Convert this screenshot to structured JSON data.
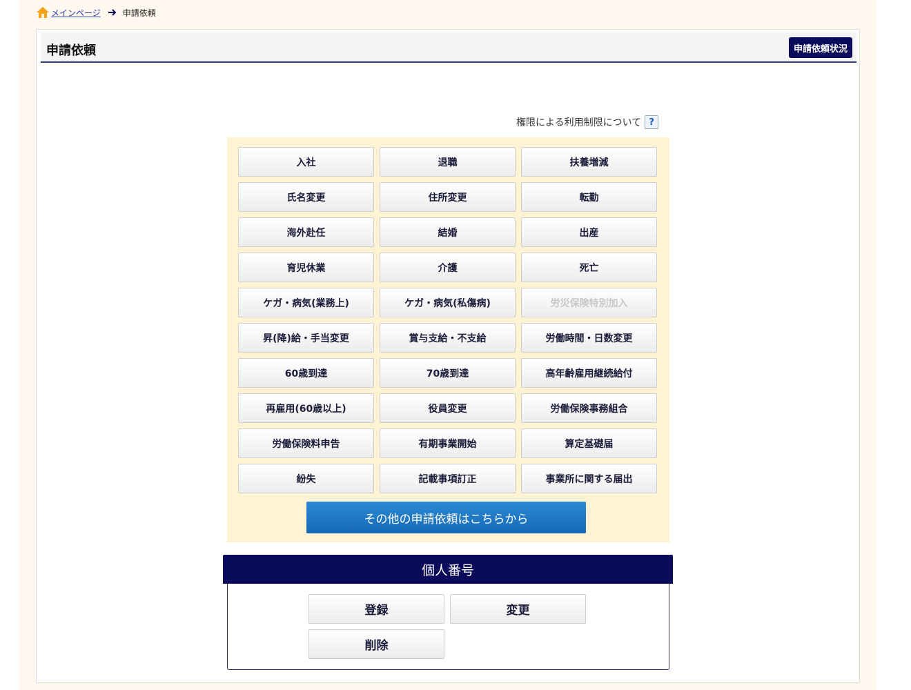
{
  "breadcrumb": {
    "home_icon": "home-icon",
    "home_label": "メインページ",
    "current": "申請依頼"
  },
  "header": {
    "title": "申請依頼",
    "status_button": "申請依頼状況"
  },
  "restriction": {
    "label": "権限による利用制限について",
    "help": "?"
  },
  "applications": [
    {
      "label": "入社",
      "enabled": true
    },
    {
      "label": "退職",
      "enabled": true
    },
    {
      "label": "扶養増減",
      "enabled": true
    },
    {
      "label": "氏名変更",
      "enabled": true
    },
    {
      "label": "住所変更",
      "enabled": true
    },
    {
      "label": "転勤",
      "enabled": true
    },
    {
      "label": "海外赴任",
      "enabled": true
    },
    {
      "label": "結婚",
      "enabled": true
    },
    {
      "label": "出産",
      "enabled": true
    },
    {
      "label": "育児休業",
      "enabled": true
    },
    {
      "label": "介護",
      "enabled": true
    },
    {
      "label": "死亡",
      "enabled": true
    },
    {
      "label": "ケガ・病気(業務上)",
      "enabled": true
    },
    {
      "label": "ケガ・病気(私傷病)",
      "enabled": true
    },
    {
      "label": "労災保険特別加入",
      "enabled": false
    },
    {
      "label": "昇(降)給・手当変更",
      "enabled": true
    },
    {
      "label": "賞与支給・不支給",
      "enabled": true
    },
    {
      "label": "労働時間・日数変更",
      "enabled": true
    },
    {
      "label": "60歳到達",
      "enabled": true
    },
    {
      "label": "70歳到達",
      "enabled": true
    },
    {
      "label": "高年齢雇用継続給付",
      "enabled": true
    },
    {
      "label": "再雇用(60歳以上)",
      "enabled": true
    },
    {
      "label": "役員変更",
      "enabled": true
    },
    {
      "label": "労働保険事務組合",
      "enabled": true
    },
    {
      "label": "労働保険料申告",
      "enabled": true
    },
    {
      "label": "有期事業開始",
      "enabled": true
    },
    {
      "label": "算定基礎届",
      "enabled": true
    },
    {
      "label": "紛失",
      "enabled": true
    },
    {
      "label": "記載事項訂正",
      "enabled": true
    },
    {
      "label": "事業所に関する届出",
      "enabled": true
    }
  ],
  "other_button": "その他の申請依頼はこちらから",
  "my_number": {
    "title": "個人番号",
    "buttons": [
      "登録",
      "変更",
      "削除"
    ]
  },
  "colors": {
    "accent_navy": "#0b0b5c",
    "primary_blue": "#1a78c2",
    "grid_bg": "#fff3d4",
    "page_bg": "#fff8ee"
  }
}
